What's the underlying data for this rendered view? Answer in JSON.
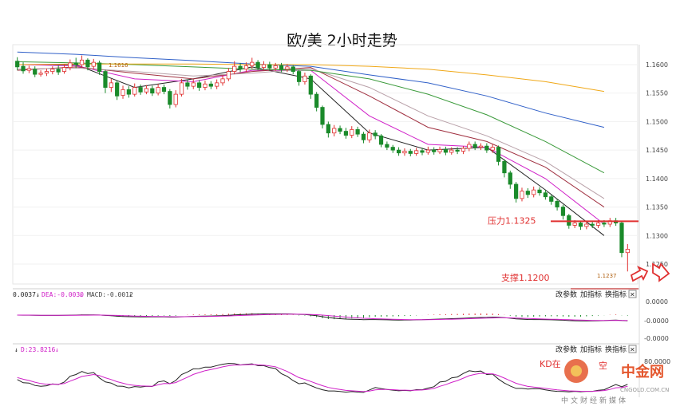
{
  "title": "欧/美 2小时走势",
  "chart_data": {
    "type": "candlestick",
    "title": "欧/美 2小时走势",
    "y_axis": {
      "ylim": [
        1.1215,
        1.1635
      ],
      "ticks": [
        "1.1600",
        "1.1550",
        "1.1500",
        "1.1450",
        "1.1400",
        "1.1350",
        "1.1300",
        "1.1250"
      ],
      "position": "right"
    },
    "high_label": "1.1616",
    "low_label": "1.1237",
    "annotations": [
      {
        "text": "压力1.1325",
        "level": 1.1325,
        "color": "#e03030"
      },
      {
        "text": "支撑1.1200",
        "level": 1.12,
        "color": "#e03030"
      }
    ],
    "candles": [
      [
        1.1606,
        1.1596,
        1.1613,
        1.159
      ],
      [
        1.1597,
        1.1589,
        1.1604,
        1.1584
      ],
      [
        1.159,
        1.1593,
        1.1598,
        1.1585
      ],
      [
        1.1592,
        1.1583,
        1.1597,
        1.1578
      ],
      [
        1.1583,
        1.1585,
        1.159,
        1.1579
      ],
      [
        1.1585,
        1.1588,
        1.1593,
        1.158
      ],
      [
        1.1588,
        1.1592,
        1.1597,
        1.1583
      ],
      [
        1.1592,
        1.1587,
        1.1598,
        1.1582
      ],
      [
        1.1588,
        1.1595,
        1.1601,
        1.1584
      ],
      [
        1.1595,
        1.1603,
        1.1609,
        1.159
      ],
      [
        1.1603,
        1.16,
        1.1612,
        1.1594
      ],
      [
        1.16,
        1.1608,
        1.1616,
        1.1596
      ],
      [
        1.1608,
        1.1596,
        1.1611,
        1.159
      ],
      [
        1.1597,
        1.1604,
        1.161,
        1.1592
      ],
      [
        1.1603,
        1.1588,
        1.1607,
        1.1582
      ],
      [
        1.1588,
        1.156,
        1.1591,
        1.155
      ],
      [
        1.156,
        1.1568,
        1.1575,
        1.1552
      ],
      [
        1.1568,
        1.1545,
        1.1572,
        1.1538
      ],
      [
        1.1546,
        1.1556,
        1.1563,
        1.154
      ],
      [
        1.1556,
        1.1548,
        1.1562,
        1.1542
      ],
      [
        1.1548,
        1.156,
        1.1567,
        1.1544
      ],
      [
        1.156,
        1.1552,
        1.1565,
        1.1547
      ],
      [
        1.1552,
        1.1558,
        1.1564,
        1.1548
      ],
      [
        1.1558,
        1.155,
        1.1563,
        1.1545
      ],
      [
        1.155,
        1.156,
        1.1566,
        1.1546
      ],
      [
        1.156,
        1.1553,
        1.1565,
        1.1548
      ],
      [
        1.1553,
        1.153,
        1.1557,
        1.1523
      ],
      [
        1.153,
        1.1548,
        1.1555,
        1.1525
      ],
      [
        1.1548,
        1.1568,
        1.1575,
        1.1544
      ],
      [
        1.1568,
        1.1562,
        1.1574,
        1.1556
      ],
      [
        1.1562,
        1.1568,
        1.1574,
        1.1557
      ],
      [
        1.1568,
        1.156,
        1.1573,
        1.1554
      ],
      [
        1.156,
        1.1566,
        1.1572,
        1.1555
      ],
      [
        1.1566,
        1.1562,
        1.1571,
        1.1557
      ],
      [
        1.1562,
        1.1568,
        1.1574,
        1.1557
      ],
      [
        1.1568,
        1.1575,
        1.1581,
        1.1563
      ],
      [
        1.1575,
        1.1588,
        1.1594,
        1.1571
      ],
      [
        1.1588,
        1.1597,
        1.1606,
        1.1583
      ],
      [
        1.1597,
        1.1592,
        1.1603,
        1.1587
      ],
      [
        1.1592,
        1.1598,
        1.1604,
        1.1587
      ],
      [
        1.1598,
        1.1604,
        1.1612,
        1.1593
      ],
      [
        1.1604,
        1.1595,
        1.1608,
        1.159
      ],
      [
        1.1595,
        1.16,
        1.1606,
        1.159
      ],
      [
        1.16,
        1.1594,
        1.1605,
        1.1589
      ],
      [
        1.1594,
        1.1598,
        1.1603,
        1.1589
      ],
      [
        1.1598,
        1.1592,
        1.1603,
        1.1587
      ],
      [
        1.1592,
        1.1596,
        1.1601,
        1.1587
      ],
      [
        1.1596,
        1.1588,
        1.1599,
        1.1583
      ],
      [
        1.1588,
        1.157,
        1.1591,
        1.1563
      ],
      [
        1.157,
        1.158,
        1.1586,
        1.1565
      ],
      [
        1.158,
        1.1548,
        1.1583,
        1.154
      ],
      [
        1.1548,
        1.1525,
        1.1552,
        1.1518
      ],
      [
        1.1525,
        1.1495,
        1.1528,
        1.1488
      ],
      [
        1.1495,
        1.148,
        1.15,
        1.1472
      ],
      [
        1.148,
        1.1488,
        1.1494,
        1.1474
      ],
      [
        1.1488,
        1.1483,
        1.1493,
        1.1478
      ],
      [
        1.1483,
        1.1476,
        1.1489,
        1.147
      ],
      [
        1.1476,
        1.1486,
        1.1492,
        1.1471
      ],
      [
        1.1486,
        1.1478,
        1.1491,
        1.1473
      ],
      [
        1.1478,
        1.1468,
        1.1482,
        1.1462
      ],
      [
        1.1468,
        1.148,
        1.1486,
        1.1463
      ],
      [
        1.148,
        1.1475,
        1.1485,
        1.1469
      ],
      [
        1.1475,
        1.146,
        1.1478,
        1.1455
      ],
      [
        1.146,
        1.1455,
        1.1465,
        1.145
      ],
      [
        1.1455,
        1.145,
        1.1459,
        1.1445
      ],
      [
        1.145,
        1.1445,
        1.1455,
        1.144
      ],
      [
        1.1445,
        1.1448,
        1.1453,
        1.144
      ],
      [
        1.1448,
        1.1444,
        1.1452,
        1.1439
      ],
      [
        1.1444,
        1.1449,
        1.1454,
        1.144
      ],
      [
        1.1449,
        1.1446,
        1.1454,
        1.1441
      ],
      [
        1.1446,
        1.145,
        1.1456,
        1.1442
      ],
      [
        1.145,
        1.1447,
        1.1455,
        1.1442
      ],
      [
        1.1447,
        1.1451,
        1.1456,
        1.1443
      ],
      [
        1.1451,
        1.1446,
        1.1456,
        1.1441
      ],
      [
        1.1446,
        1.145,
        1.1455,
        1.1442
      ],
      [
        1.145,
        1.1448,
        1.1455,
        1.1443
      ],
      [
        1.1448,
        1.1453,
        1.1457,
        1.1443
      ],
      [
        1.1453,
        1.146,
        1.1465,
        1.1448
      ],
      [
        1.146,
        1.1455,
        1.1465,
        1.145
      ],
      [
        1.1455,
        1.1457,
        1.1462,
        1.145
      ],
      [
        1.1457,
        1.145,
        1.1462,
        1.1445
      ],
      [
        1.145,
        1.1455,
        1.146,
        1.1445
      ],
      [
        1.1455,
        1.143,
        1.1458,
        1.1423
      ],
      [
        1.143,
        1.141,
        1.1434,
        1.1402
      ],
      [
        1.141,
        1.139,
        1.1414,
        1.1382
      ],
      [
        1.139,
        1.1365,
        1.1394,
        1.1358
      ],
      [
        1.1365,
        1.1378,
        1.1384,
        1.136
      ],
      [
        1.1378,
        1.1372,
        1.1383,
        1.1366
      ],
      [
        1.1372,
        1.138,
        1.1386,
        1.1367
      ],
      [
        1.138,
        1.1375,
        1.1385,
        1.137
      ],
      [
        1.1375,
        1.1368,
        1.138,
        1.1363
      ],
      [
        1.1368,
        1.136,
        1.1372,
        1.1354
      ],
      [
        1.136,
        1.135,
        1.1364,
        1.1344
      ],
      [
        1.135,
        1.1335,
        1.1354,
        1.1328
      ],
      [
        1.1335,
        1.1318,
        1.1338,
        1.1312
      ],
      [
        1.1318,
        1.1322,
        1.1327,
        1.1313
      ],
      [
        1.1322,
        1.1316,
        1.1326,
        1.131
      ],
      [
        1.1316,
        1.132,
        1.1325,
        1.1311
      ],
      [
        1.132,
        1.1318,
        1.1324,
        1.1313
      ],
      [
        1.1318,
        1.1322,
        1.1327,
        1.1313
      ],
      [
        1.1322,
        1.132,
        1.1327,
        1.1315
      ],
      [
        1.132,
        1.1326,
        1.1331,
        1.1315
      ],
      [
        1.1326,
        1.1322,
        1.1331,
        1.1317
      ],
      [
        1.1322,
        1.127,
        1.1325,
        1.1262
      ],
      [
        1.127,
        1.1276,
        1.1285,
        1.1237
      ]
    ],
    "moving_averages": [
      {
        "color": "#222222",
        "values_every_10_bars": [
          1.16,
          1.16,
          1.156,
          1.1575,
          1.1596,
          1.1575,
          1.148,
          1.145,
          1.1455,
          1.138,
          1.13
        ]
      },
      {
        "color": "#d020c8",
        "values_every_10_bars": [
          1.16,
          1.1598,
          1.1575,
          1.157,
          1.159,
          1.159,
          1.151,
          1.146,
          1.1455,
          1.14,
          1.132
        ]
      },
      {
        "color": "#a03040",
        "values_every_10_bars": [
          1.159,
          1.1596,
          1.1585,
          1.1575,
          1.1588,
          1.1595,
          1.1545,
          1.149,
          1.1465,
          1.142,
          1.135
        ]
      },
      {
        "color": "#b8a0a8",
        "values_every_10_bars": [
          1.1592,
          1.1594,
          1.1588,
          1.158,
          1.1585,
          1.1593,
          1.156,
          1.151,
          1.1475,
          1.143,
          1.1365
        ]
      },
      {
        "color": "#3a9a3a",
        "values_every_10_bars": [
          1.1605,
          1.1603,
          1.16,
          1.1596,
          1.1592,
          1.159,
          1.1575,
          1.1548,
          1.1512,
          1.1465,
          1.141
        ]
      },
      {
        "color": "#3060c8",
        "values_every_10_bars": [
          1.1622,
          1.1618,
          1.1612,
          1.1607,
          1.1601,
          1.1597,
          1.1582,
          1.1568,
          1.1545,
          1.1515,
          1.149
        ]
      },
      {
        "color": "#f0a818",
        "values_every_10_bars": [
          1.16,
          1.1601,
          1.1601,
          1.1601,
          1.16,
          1.16,
          1.1597,
          1.1592,
          1.1582,
          1.157,
          1.1553
        ]
      }
    ],
    "macd_panel": {
      "header_fragments": [
        "0.0037",
        "DEA:-0.0030",
        "MACD:-0.0012"
      ],
      "ticks": [
        "0.0000",
        "-0.0000",
        "-0.0000"
      ]
    },
    "kd_panel": {
      "header_fragments": [
        "D:23.8216"
      ],
      "ticks": [
        "80.0000"
      ],
      "overlay_text": [
        "KD在",
        "空"
      ]
    }
  },
  "toolbar": {
    "change_params": "改参数",
    "add_indicator": "加指标",
    "switch_indicator": "换指标",
    "close": "✕"
  },
  "watermark": {
    "brand": "中金网",
    "url": "CNGOLD.COM.CN",
    "slogan": "中文财经新媒体"
  },
  "colors": {
    "up": "#e03030",
    "down": "#1a8a2a",
    "annotation": "#e03030",
    "macd_line": "#222222",
    "signal_line": "#d020c8"
  }
}
